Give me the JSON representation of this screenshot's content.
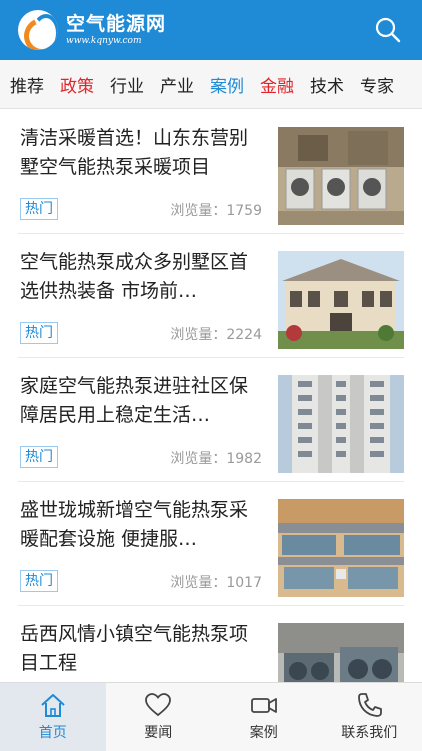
{
  "header": {
    "logo_title": "空气能源网",
    "logo_url": "www.kqnyw.com"
  },
  "tabs": [
    {
      "label": "推荐",
      "color": "#222222"
    },
    {
      "label": "政策",
      "color": "#e0262b"
    },
    {
      "label": "行业",
      "color": "#222222"
    },
    {
      "label": "产业",
      "color": "#222222"
    },
    {
      "label": "案例",
      "color": "#1f8ad6"
    },
    {
      "label": "金融",
      "color": "#e0262b"
    },
    {
      "label": "技术",
      "color": "#222222"
    },
    {
      "label": "专家",
      "color": "#222222"
    }
  ],
  "articles": [
    {
      "title": "清洁采暖首选！山东东营别墅空气能热泵采暖项目",
      "badge": "热门",
      "views": "浏览量：1759"
    },
    {
      "title": "空气能热泵成众多别墅区首选供热装备 市场前…",
      "badge": "热门",
      "views": "浏览量：2224"
    },
    {
      "title": "家庭空气能热泵进驻社区保障居民用上稳定生活…",
      "badge": "热门",
      "views": "浏览量：1982"
    },
    {
      "title": "盛世珑城新增空气能热泵采暖配套设施 便捷服…",
      "badge": "热门",
      "views": "浏览量：1017"
    },
    {
      "title": "岳西风情小镇空气能热泵项目工程",
      "badge": "",
      "views": ""
    }
  ],
  "bottom_nav": [
    {
      "label": "首页",
      "icon": "home-icon",
      "active": true
    },
    {
      "label": "要闻",
      "icon": "heart-icon",
      "active": false
    },
    {
      "label": "案例",
      "icon": "video-camera-icon",
      "active": false
    },
    {
      "label": "联系我们",
      "icon": "phone-icon",
      "active": false
    }
  ],
  "colors": {
    "brand_blue": "#1f8ad6",
    "accent_red": "#e0262b"
  }
}
